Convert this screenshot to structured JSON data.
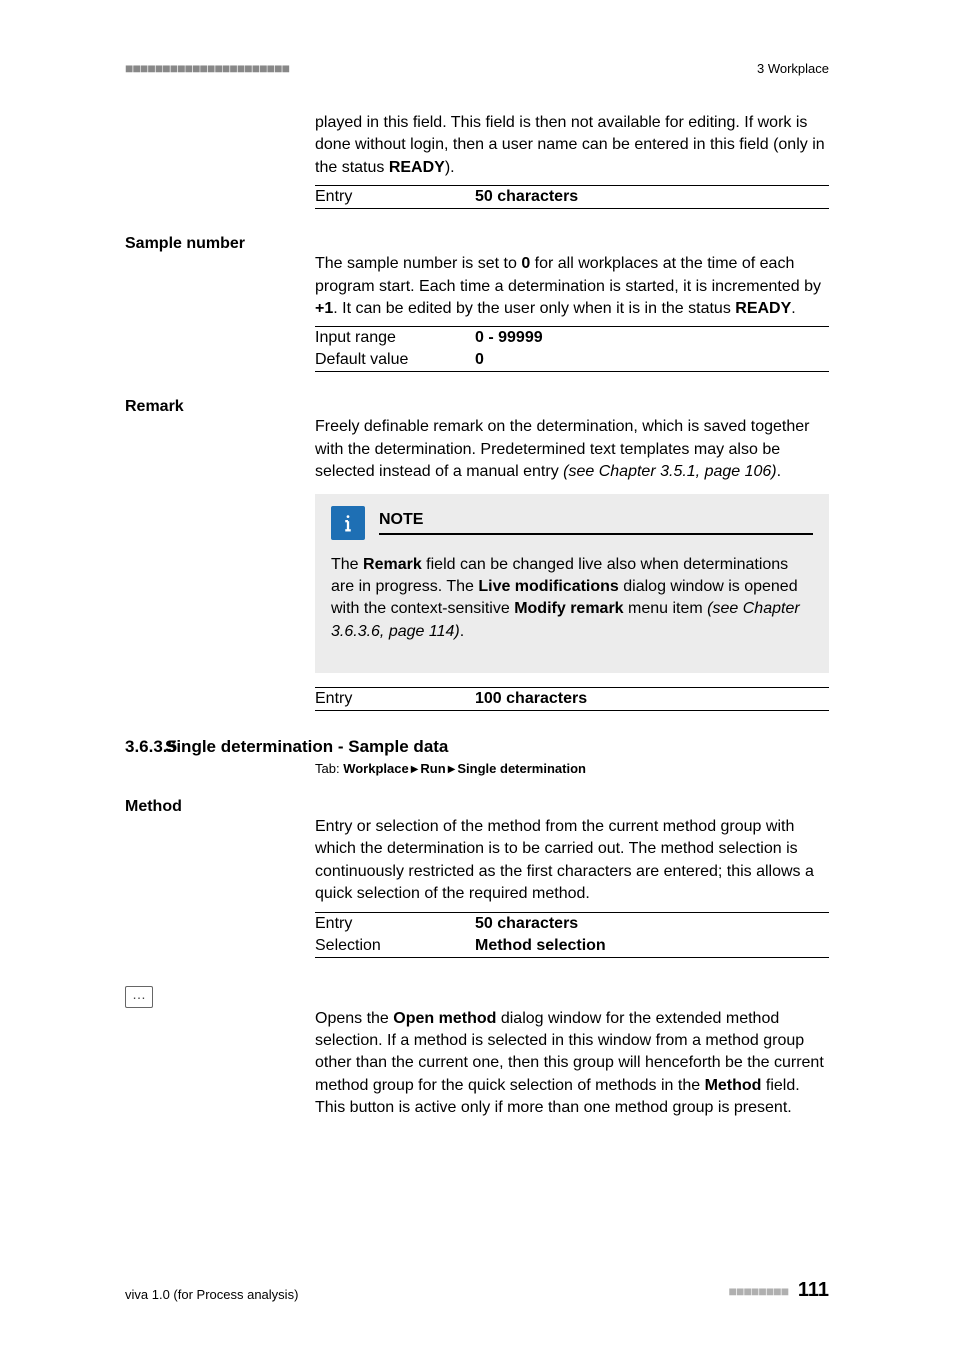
{
  "header": {
    "dashes": "■■■■■■■■■■■■■■■■■■■■■■",
    "section": "3 Workplace"
  },
  "intro_para_a": "played in this field. This field is then not available for editing. If work is done without login, then a user name can be entered in this field (only in the status ",
  "intro_para_b": "READY",
  "intro_para_c": ").",
  "intro_table": {
    "k": "Entry",
    "v": "50 characters"
  },
  "sample_number": {
    "label": "Sample number",
    "para_a": "The sample number is set to ",
    "para_b": "0",
    "para_c": " for all workplaces at the time of each program start. Each time a determination is started, it is incremented by ",
    "para_d": "+1",
    "para_e": ". It can be edited by the user only when it is in the status ",
    "para_f": "READY",
    "para_g": ".",
    "tbl": [
      {
        "k": "Input range",
        "v": "0 - 99999"
      },
      {
        "k": "Default value",
        "v": "0"
      }
    ]
  },
  "remark": {
    "label": "Remark",
    "para_a": "Freely definable remark on the determination, which is saved together with the determination. Predetermined text templates may also be selected instead of a manual entry ",
    "para_b": "(see Chapter 3.5.1, page 106)",
    "para_c": ".",
    "note_title": "NOTE",
    "note_a": "The ",
    "note_b": "Remark",
    "note_c": " field can be changed live also when determinations are in progress. The ",
    "note_d": "Live modifications",
    "note_e": " dialog window is opened with the context-sensitive ",
    "note_f": "Modify remark",
    "note_g": " menu item ",
    "note_h": "(see Chapter 3.6.3.6, page 114)",
    "note_i": ".",
    "tbl": {
      "k": "Entry",
      "v": "100 characters"
    }
  },
  "subsection": {
    "num": "3.6.3.5",
    "title": "Single determination - Sample data",
    "tab_prefix": "Tab: ",
    "tab_path": [
      "Workplace",
      "Run",
      "Single determination"
    ]
  },
  "method": {
    "label": "Method",
    "para": "Entry or selection of the method from the current method group with which the determination is to be carried out. The method selection is continuously restricted as the first characters are entered; this allows a quick selection of the required method.",
    "tbl": [
      {
        "k": "Entry",
        "v": "50 characters"
      },
      {
        "k": "Selection",
        "v": "Method selection"
      }
    ]
  },
  "ellipsis": {
    "glyph": "…",
    "para_a": "Opens the ",
    "para_b": "Open method",
    "para_c": " dialog window for the extended method selection. If a method is selected in this window from a method group other than the current one, then this group will henceforth be the current method group for the quick selection of methods in the ",
    "para_d": "Method",
    "para_e": " field. This button is active only if more than one method group is present."
  },
  "footer": {
    "left": "viva 1.0 (for Process analysis)",
    "dashes": "■■■■■■■■",
    "page": "111"
  }
}
